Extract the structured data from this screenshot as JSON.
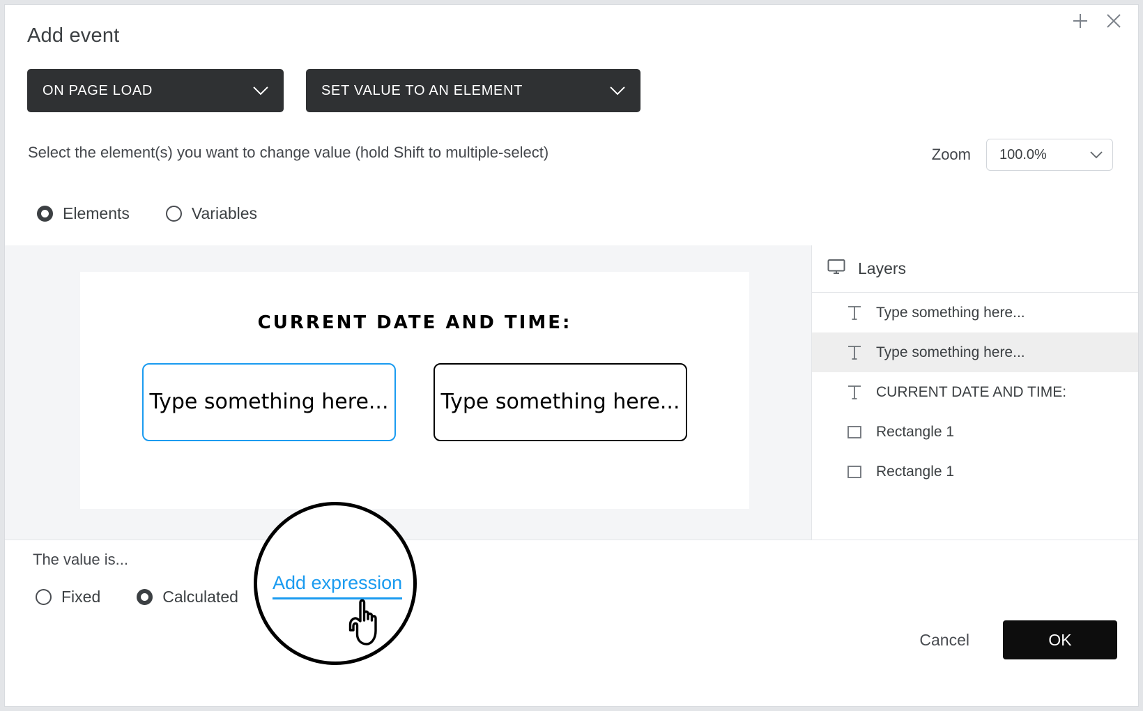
{
  "dialog": {
    "title": "Add event",
    "add_icon": "plus-icon",
    "close_icon": "close-icon"
  },
  "selectors": {
    "trigger": {
      "label": "ON PAGE LOAD",
      "chevron": "chevron-down-icon"
    },
    "action": {
      "label": "SET VALUE TO AN ELEMENT",
      "chevron": "chevron-down-icon"
    }
  },
  "instructions": "Select the element(s) you want to change value (hold Shift to multiple-select)",
  "zoom": {
    "label": "Zoom",
    "value": "100.0%",
    "chevron": "chevron-down-icon"
  },
  "source_mode": {
    "options": [
      {
        "label": "Elements",
        "selected": true
      },
      {
        "label": "Variables",
        "selected": false
      }
    ]
  },
  "canvas": {
    "heading": "CURRENT DATE AND TIME:",
    "shapes": [
      {
        "text": "Type something here...",
        "selected": true
      },
      {
        "text": "Type something here...",
        "selected": false
      }
    ]
  },
  "layers": {
    "header": {
      "label": "Layers",
      "icon": "monitor-icon"
    },
    "rows": [
      {
        "label": "Type something here...",
        "icon": "text-icon",
        "active": false
      },
      {
        "label": "Type something here...",
        "icon": "text-icon",
        "active": true
      },
      {
        "label": "CURRENT DATE AND TIME:",
        "icon": "text-icon",
        "active": false
      },
      {
        "label": "Rectangle 1",
        "icon": "rectangle-icon",
        "active": false
      },
      {
        "label": "Rectangle 1",
        "icon": "rectangle-icon",
        "active": false
      }
    ]
  },
  "value_section": {
    "label": "The value is...",
    "options": [
      {
        "label": "Fixed",
        "selected": false
      },
      {
        "label": "Calculated",
        "selected": true
      }
    ],
    "add_expression": "Add expression"
  },
  "footer": {
    "cancel_label": "Cancel",
    "ok_label": "OK"
  },
  "magnifier": {
    "link_label": "Add expression",
    "cursor": "pointing-hand-cursor"
  },
  "colors": {
    "accent_blue": "#1a9bf0",
    "dark_control": "#2f3133",
    "stage_bg": "#f4f5f7",
    "row_highlight": "#eeeeee",
    "primary_button": "#0d0d0d"
  }
}
